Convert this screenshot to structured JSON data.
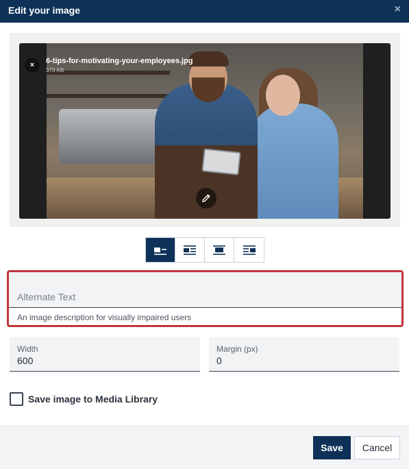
{
  "dialog": {
    "title": "Edit your image",
    "close_glyph": "×"
  },
  "image": {
    "file_name": "6-tips-for-motivating-your-employees.jpg",
    "file_size": "373 KB",
    "remove_glyph": "×",
    "description": "photo of a man and woman in a cafe looking at a tablet"
  },
  "alignment": {
    "options": [
      {
        "name": "align-left",
        "icon": "align-left-icon",
        "active": true
      },
      {
        "name": "align-left-wrap",
        "icon": "align-left-wrap-icon",
        "active": false
      },
      {
        "name": "align-center",
        "icon": "align-center-icon",
        "active": false
      },
      {
        "name": "align-right-wrap",
        "icon": "align-right-wrap-icon",
        "active": false
      }
    ]
  },
  "alt_text": {
    "placeholder": "Alternate Text",
    "value": "",
    "help": "An image description for visually impaired users"
  },
  "width": {
    "label": "Width",
    "value": "600"
  },
  "margin": {
    "label": "Margin (px)",
    "value": "0"
  },
  "media_library": {
    "label": "Save image to Media Library",
    "checked": false
  },
  "footer": {
    "save_label": "Save",
    "cancel_label": "Cancel"
  },
  "colors": {
    "header_bg": "#0d3157",
    "accent": "#0d3157",
    "error_border": "#c0353a"
  }
}
